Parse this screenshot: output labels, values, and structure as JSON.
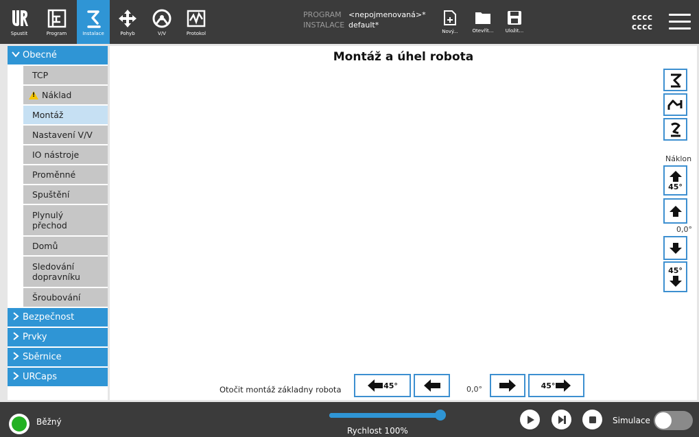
{
  "header": {
    "tabs": [
      {
        "label": "Spustit"
      },
      {
        "label": "Program"
      },
      {
        "label": "Instalace"
      },
      {
        "label": "Pohyb"
      },
      {
        "label": "V/V"
      },
      {
        "label": "Protokol"
      }
    ],
    "program_key": "PROGRAM",
    "program_value": "<nepojmenovaná>*",
    "installation_key": "INSTALACE",
    "installation_value": "default*",
    "file_buttons": [
      {
        "label": "Nový..."
      },
      {
        "label": "Otevřít..."
      },
      {
        "label": "Uložit..."
      }
    ],
    "user_line1": "cccc",
    "user_line2": "cccc"
  },
  "sidebar": {
    "group_general": "Obecné",
    "items": [
      {
        "label": "TCP"
      },
      {
        "label": "Náklad"
      },
      {
        "label": "Montáž"
      },
      {
        "label": "Nastavení V/V"
      },
      {
        "label": "IO nástroje"
      },
      {
        "label": "Proměnné"
      },
      {
        "label": "Spuštění"
      },
      {
        "label": "Plynulý přechod"
      },
      {
        "label": "Domů"
      },
      {
        "label": "Sledování dopravníku"
      },
      {
        "label": "Šroubování"
      }
    ],
    "groups": [
      {
        "label": "Bezpečnost"
      },
      {
        "label": "Prvky"
      },
      {
        "label": "Sběrnice"
      },
      {
        "label": "URCaps"
      }
    ]
  },
  "main": {
    "title": "Montáž a úhel robota",
    "tilt_label": "Náklon",
    "tilt_step": "45°",
    "tilt_value": "0,0°",
    "rotate_label": "Otočit montáž základny robota",
    "rotate_step": "45°",
    "rotate_value": "0,0°"
  },
  "footer": {
    "status": "Běžný",
    "speed_label": "Rychlost 100%",
    "speed_percent": 100,
    "simulation_label": "Simulace"
  },
  "colors": {
    "accent": "#2f95d5",
    "header_bg": "#3b3b3b",
    "status_ok": "#23b123"
  }
}
